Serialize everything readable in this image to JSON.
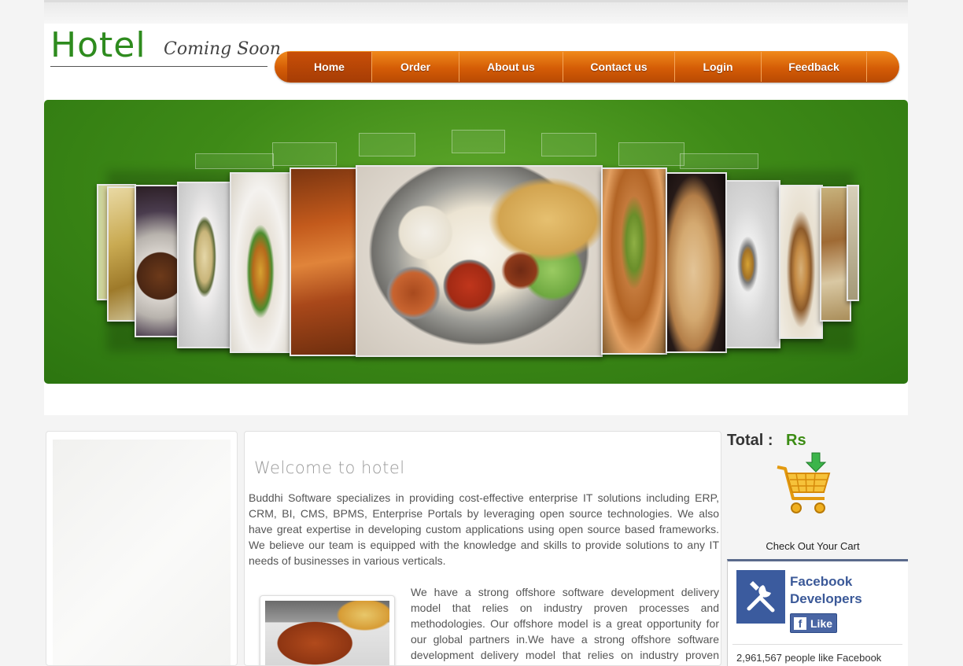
{
  "header": {
    "logo_main": "Hotel",
    "logo_sub": "Coming Soon"
  },
  "nav": {
    "items": [
      {
        "label": "Home",
        "active": true
      },
      {
        "label": "Order",
        "active": false
      },
      {
        "label": "About us",
        "active": false
      },
      {
        "label": "Contact us",
        "active": false
      },
      {
        "label": "Login",
        "active": false
      },
      {
        "label": "Feedback",
        "active": false
      }
    ]
  },
  "main": {
    "welcome_title": "Welcome to hotel",
    "para1": "Buddhi Software specializes in providing cost-effective enterprise IT solutions including ERP, CRM, BI, CMS, BPMS, Enterprise Portals by leveraging open source technologies. We also have great expertise in developing custom applications using open source based frameworks. We believe our team is equipped with the knowledge and skills to provide solutions to any IT needs of businesses in various verticals.",
    "para2": "We have a strong offshore software development delivery model that relies on industry proven processes and methodologies. Our offshore model is a great opportunity for our global partners in.We have a strong offshore software development delivery model that relies on industry proven processes and methodologies."
  },
  "sidebar_right": {
    "total_label": "Total :",
    "currency": "Rs",
    "checkout_label": "Check Out Your Cart",
    "facebook": {
      "page_name_line1": "Facebook",
      "page_name_line2": "Developers",
      "like_label": "Like",
      "like_count_text": "2,961,567 people like Facebook"
    }
  },
  "colors": {
    "brand_green": "#2e8b1e",
    "nav_orange": "#d45c06",
    "banner_green": "#3e8a17",
    "facebook_blue": "#3b5998"
  }
}
